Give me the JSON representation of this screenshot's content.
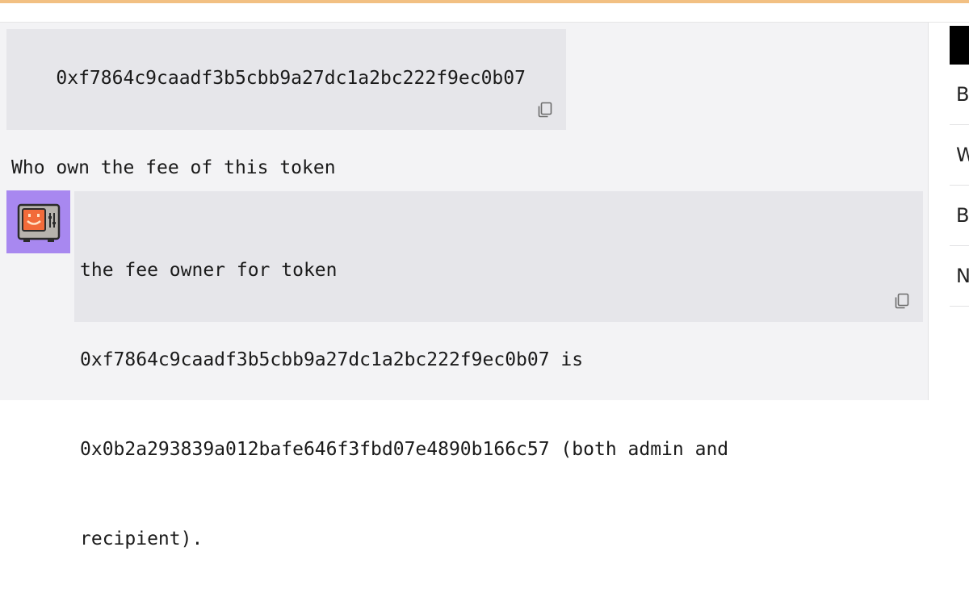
{
  "chat": {
    "user_message": {
      "address": "0xf7864c9caadf3b5cbb9a27dc1a2bc222f9ec0b07",
      "question": "Who own the fee of this token"
    },
    "bot_message": {
      "lines": [
        "the fee owner for token",
        "0xf7864c9caadf3b5cbb9a27dc1a2bc222f9ec0b07 is",
        "0x0b2a293839a012bafe646f3fbd07e4890b166c57 (both admin and",
        "recipient)."
      ]
    },
    "copy_icon": "copy-icon",
    "avatar_icon": "robot-avatar-icon"
  },
  "side_panel": {
    "rows": [
      "B",
      "W",
      "B",
      "N"
    ]
  },
  "colors": {
    "top_bar": "#f2c083",
    "avatar_bg": "#a888f0",
    "bubble_bg": "#e6e6ea",
    "panel_bg": "#f3f3f5"
  }
}
